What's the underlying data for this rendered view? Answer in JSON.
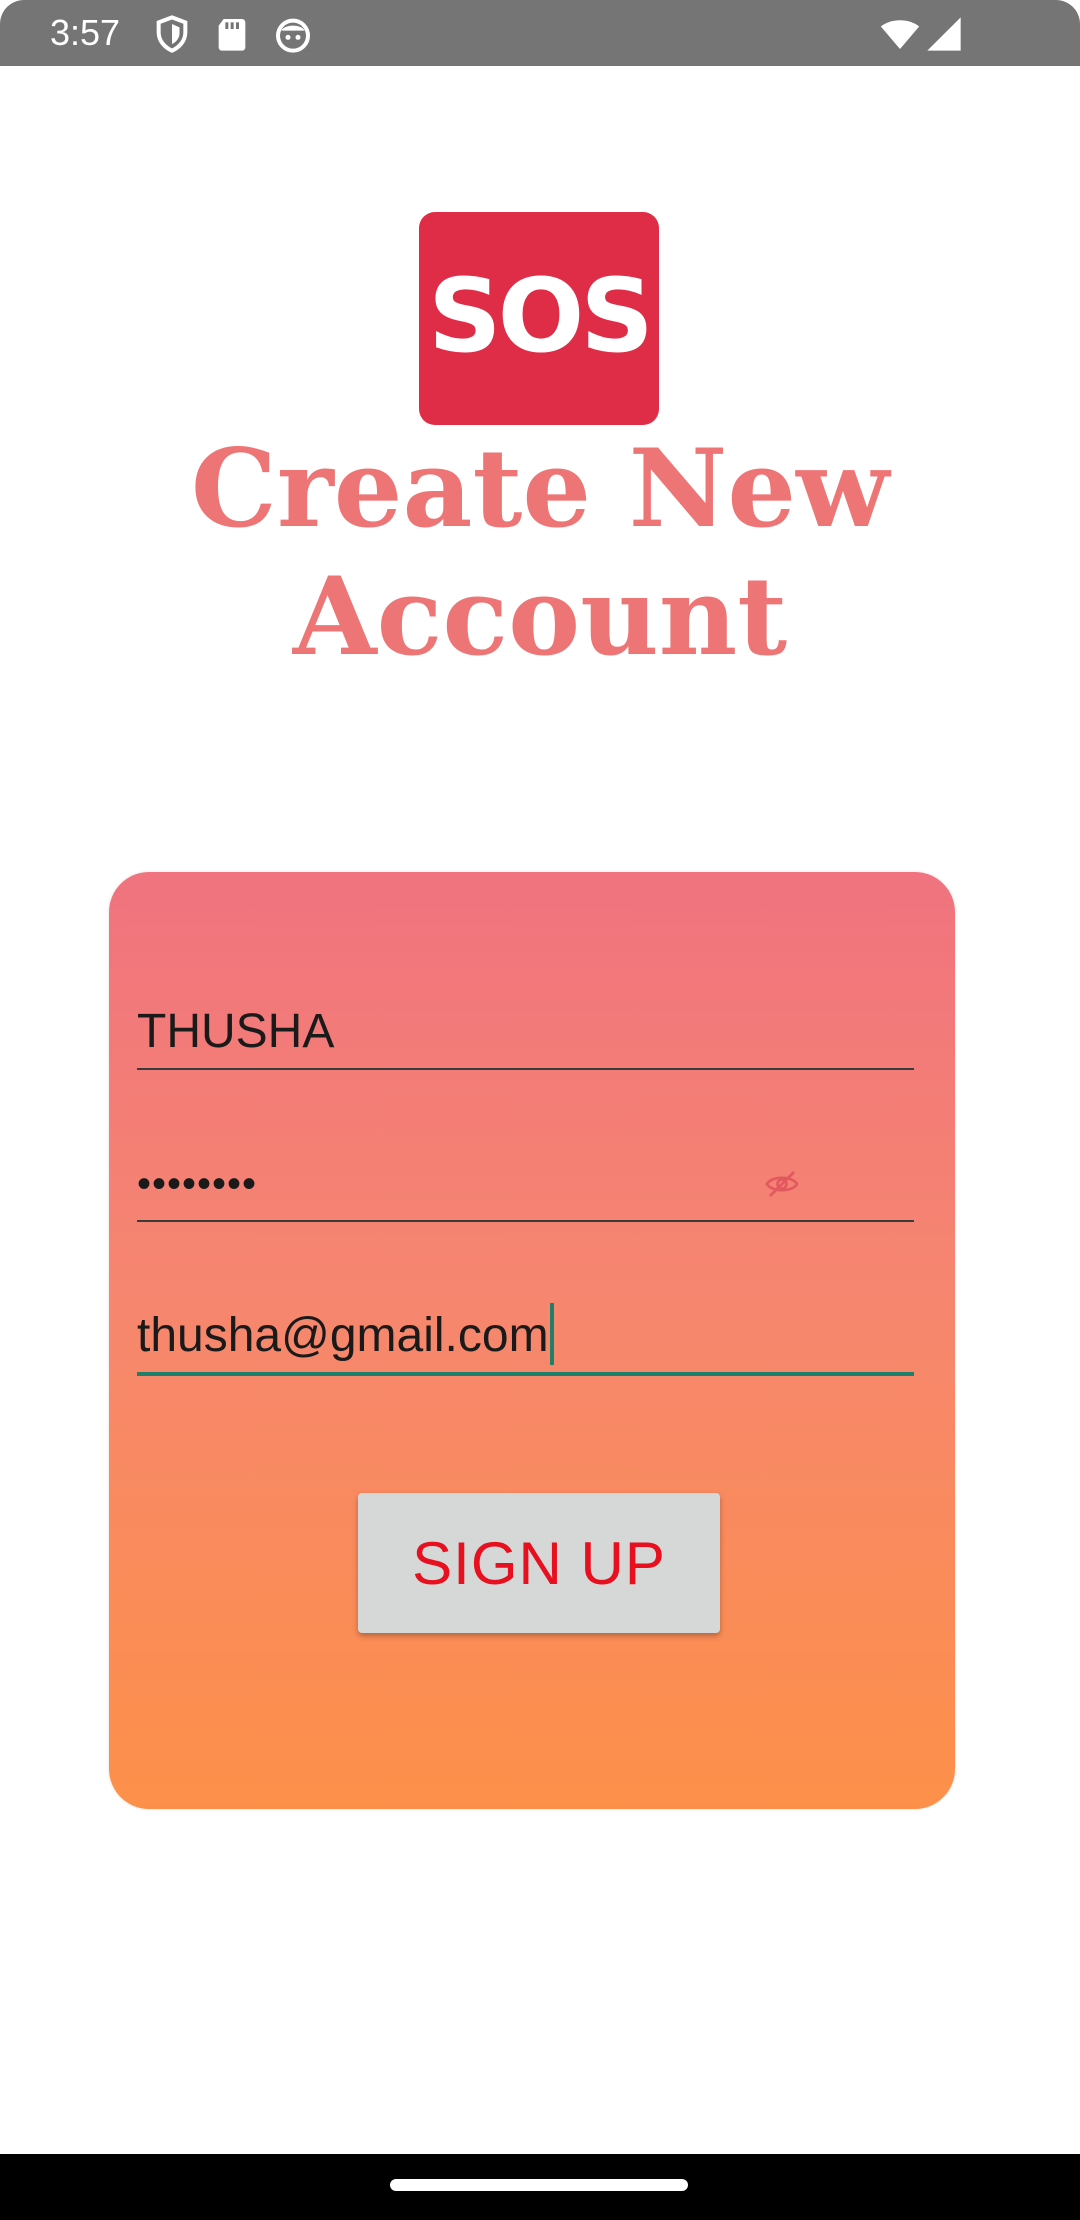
{
  "status_bar": {
    "time": "3:57",
    "left_icons": [
      "shield-icon",
      "sd-card-icon",
      "android-face-icon"
    ],
    "right_icons": [
      "wifi-icon",
      "signal-icon"
    ],
    "background": "#757575"
  },
  "logo": {
    "text": "SOS",
    "background": "#df2c47"
  },
  "title": {
    "line1": "Create New",
    "line2": "Account",
    "color": "#ee7576"
  },
  "form": {
    "username_value": "THUSHA",
    "password_value": "••••••••",
    "password_toggle_icon": "eye-off-icon",
    "email_value": "thusha@gmail.com",
    "focused_field": "email",
    "focus_color": "#1f7f6b",
    "gradient_top": "#f0737f",
    "gradient_bottom": "#fd9049"
  },
  "signup_button": {
    "label": "SIGN UP",
    "text_color": "#e8101e"
  }
}
